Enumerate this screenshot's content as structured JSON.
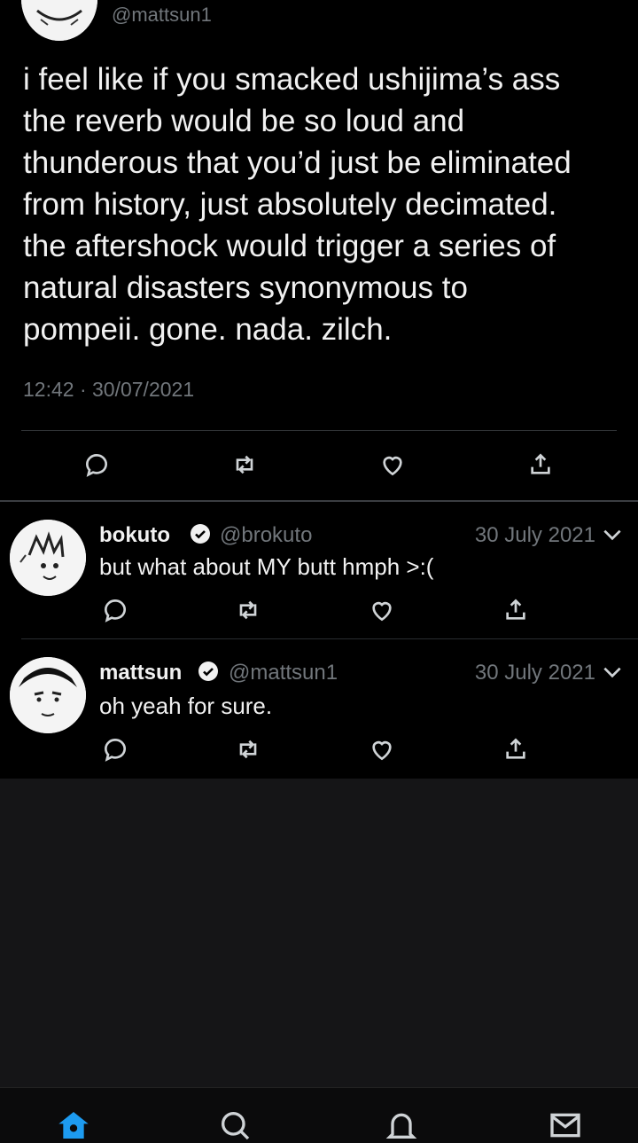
{
  "main_tweet": {
    "handle": "@mattsun1",
    "text": "i feel like if you smacked ushijima’s ass\nthe reverb would be so loud and\nthunderous that you’d just be eliminated\nfrom history, just absolutely  decimated.\nthe aftershock would trigger a series of\nnatural disasters synonymous to\npompeii. gone. nada. zilch.",
    "timestamp": "12:42 · 30/07/2021",
    "actions": [
      "reply-icon",
      "retweet-icon",
      "like-icon",
      "share-icon"
    ]
  },
  "replies": [
    {
      "name": "bokuto",
      "handle": "@brokuto",
      "date": "30 July 2021",
      "text": "but what about MY butt hmph >:(",
      "verified": true
    },
    {
      "name": "mattsun",
      "handle": "@mattsun1",
      "date": "30 July 2021",
      "text": "oh yeah for sure.",
      "verified": true
    }
  ],
  "tabbar": {
    "tabs": [
      "home-icon",
      "search-icon",
      "notifications-icon",
      "messages-icon"
    ],
    "active": "home-icon",
    "accent": "#1d9bf0"
  },
  "colors": {
    "background": "#000000",
    "secondary_text": "#71767b",
    "accent": "#1d9bf0"
  }
}
